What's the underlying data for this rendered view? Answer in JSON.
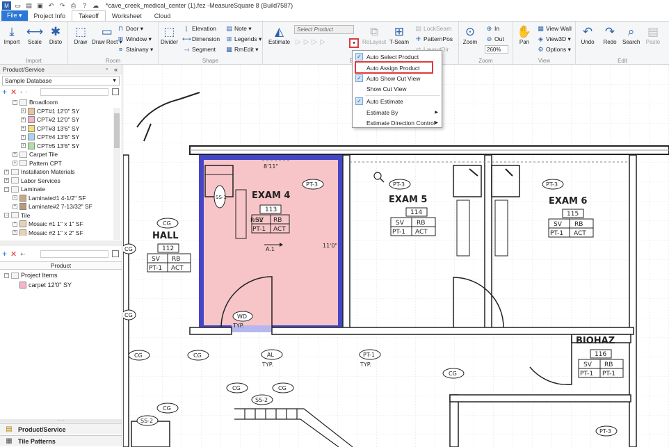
{
  "titlebar": {
    "title": "*cave_creek_medical_center (1).fez -MeasureSquare 8 (Build7587)",
    "app_icon": "app-icon",
    "quick": [
      "new-icon",
      "open-icon",
      "save-icon",
      "undo-icon",
      "redo-icon",
      "print-icon",
      "help-icon",
      "cloud-icon"
    ],
    "help": "?"
  },
  "tabs": [
    "File ▾",
    "Project Info",
    "Takeoff",
    "Worksheet",
    "Cloud"
  ],
  "ribbon": {
    "import": {
      "label": "Import",
      "buttons": [
        "Import",
        "Scale",
        "Disto"
      ]
    },
    "room": {
      "label": "Room",
      "buttons": [
        "Draw",
        "Draw Rect ▾",
        "Door ▾",
        "Window ▾",
        "Stairway ▾"
      ]
    },
    "shape": {
      "label": "Shape",
      "buttons": [
        "Divider",
        "Elevation",
        "Dimension",
        "Segment",
        "Note ▾",
        "Legends ▾",
        "RmEdit ▾"
      ]
    },
    "estimate": {
      "label": "Estimate",
      "big": "Estimate",
      "product_placeholder": "Select Product",
      "relayout": "ReLayout",
      "tseam": "T-Seam",
      "lockseam": "LockSeam",
      "patternpos": "PatternPos",
      "layoutdir": "LayoutDir"
    },
    "zoom": {
      "label": "Zoom",
      "zoom": "Zoom",
      "in": "In",
      "out": "Out",
      "level": "260%"
    },
    "view": {
      "label": "View",
      "pan": "Pan",
      "viewwall": "View Wall",
      "view3d": "View3D ▾",
      "options": "Options ▾"
    },
    "edit": {
      "label": "Edit",
      "buttons": [
        "Undo",
        "Redo",
        "Search",
        "Paste"
      ]
    }
  },
  "left_panel": {
    "title": "Product/Service",
    "pin": "Ά",
    "close": "«",
    "database": "Sample Database",
    "tree": [
      {
        "label": "Broadloom",
        "level": 2,
        "type": "folder",
        "exp": "−"
      },
      {
        "label": "CPT#1 12'0\" SY",
        "level": 3,
        "color": "#e8c49a"
      },
      {
        "label": "CPT#2 12'0\" SY",
        "level": 3,
        "color": "#f7b3c8"
      },
      {
        "label": "CPT#3 13'6\" SY",
        "level": 3,
        "color": "#f2e07a"
      },
      {
        "label": "CPT#4 13'6\" SY",
        "level": 3,
        "color": "#a8d4ef"
      },
      {
        "label": "CPT#5 13'6\" SY",
        "level": 3,
        "color": "#a9e3a0"
      },
      {
        "label": "Carpet Tile",
        "level": 2,
        "type": "folder",
        "exp": "+"
      },
      {
        "label": "Pattern CPT",
        "level": 2,
        "type": "folder",
        "exp": "+"
      },
      {
        "label": "Installation Materials",
        "level": 1,
        "type": "folder",
        "exp": "+"
      },
      {
        "label": "Labor Services",
        "level": 1,
        "type": "folder",
        "exp": "+"
      },
      {
        "label": "Laminate",
        "level": 1,
        "type": "folder",
        "exp": "−"
      },
      {
        "label": "Laminate#1 4-1/2\" SF",
        "level": 2,
        "color": "#c8a882"
      },
      {
        "label": "Laminate#2 7-13/32\" SF",
        "level": 2,
        "color": "#b89a7a"
      },
      {
        "label": "Tile",
        "level": 1,
        "type": "folder",
        "exp": "−"
      },
      {
        "label": "Mosaic #1 1\" x 1\" SF",
        "level": 2,
        "color": "#e6d3b0"
      },
      {
        "label": "Mosaic #2 1\" x 2\" SF",
        "level": 2,
        "color": "#e6d3b0"
      }
    ],
    "product_header": "Product",
    "project_items": "Project Items",
    "project_item": {
      "label": "carpet 12'0\" SY",
      "color": "#f7b3c8"
    },
    "bottom_tabs": [
      "Product/Service",
      "Tile Patterns"
    ]
  },
  "dropdown": {
    "items": [
      {
        "label": "Auto Select Product",
        "checked": true
      },
      {
        "label": "Auto Assign Product",
        "checked": false,
        "highlighted": true
      },
      {
        "label": "Auto Show Cut View",
        "checked": true
      },
      {
        "label": "Show Cut View",
        "checked": false
      },
      {
        "label": "Auto Estimate",
        "checked": true
      },
      {
        "label": "Estimate By",
        "submenu": true
      },
      {
        "label": "Estimate Direction Control",
        "submenu": true
      }
    ]
  },
  "canvas": {
    "rooms": [
      {
        "name": "EXAM 4",
        "num": "113",
        "f1": "SV",
        "f2": "RB",
        "f3": "PT-1",
        "f4": "ACT"
      },
      {
        "name": "EXAM 5",
        "num": "114",
        "f1": "SV",
        "f2": "RB",
        "f3": "PT-1",
        "f4": "ACT"
      },
      {
        "name": "EXAM 6",
        "num": "115",
        "f1": "SV",
        "f2": "RB",
        "f3": "PT-1",
        "f4": "ACT"
      },
      {
        "name": "HALL",
        "num": "112",
        "f1": "SV",
        "f2": "RB",
        "f3": "PT-1",
        "f4": "ACT"
      },
      {
        "name": "BIOHAZ",
        "num": "116",
        "f1": "SV",
        "f2": "RB",
        "f3": "PT-1",
        "f4": "PT-1"
      }
    ],
    "dims": {
      "top": "8'11\"",
      "side": "11'0\""
    },
    "room_label": "Rm2",
    "arrow_label": "A.1",
    "tags": [
      "CG",
      "CG",
      "CG",
      "CG",
      "CG",
      "CG",
      "CG",
      "CG",
      "CG",
      "PT-3",
      "PT-3",
      "PT-3",
      "PT-3",
      "SS-1",
      "SS-2",
      "SS-2",
      "AL",
      "TYP.",
      "PT-1",
      "TYP.",
      "WD",
      "TYP."
    ],
    "accent_room": "#f7c5c8",
    "accent_border": "#4545c8"
  }
}
